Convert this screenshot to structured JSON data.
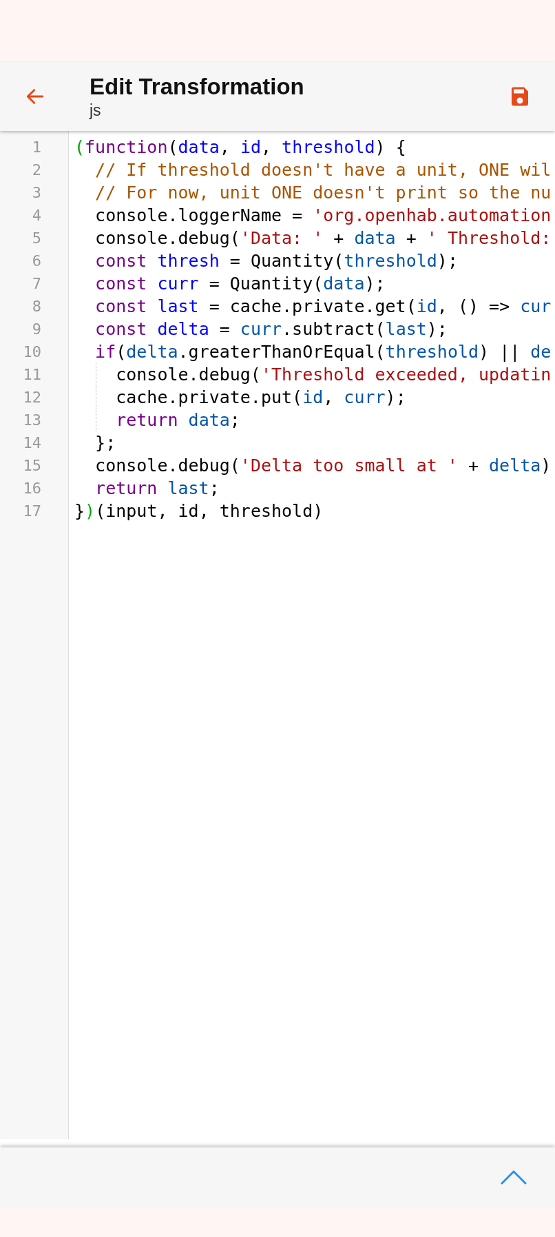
{
  "header": {
    "title": "Edit Transformation",
    "subtitle": "js"
  },
  "editor": {
    "lines": [
      {
        "number": "1",
        "tokens": [
          {
            "kind": "bracket",
            "text": "("
          },
          {
            "kind": "keyword",
            "text": "function"
          },
          {
            "kind": "plain",
            "text": "("
          },
          {
            "kind": "def",
            "text": "data"
          },
          {
            "kind": "plain",
            "text": ", "
          },
          {
            "kind": "def",
            "text": "id"
          },
          {
            "kind": "plain",
            "text": ", "
          },
          {
            "kind": "def",
            "text": "threshold"
          },
          {
            "kind": "plain",
            "text": ") {"
          }
        ]
      },
      {
        "number": "2",
        "tokens": [
          {
            "kind": "comment",
            "text": "  // If threshold doesn't have a unit, ONE wil"
          }
        ]
      },
      {
        "number": "3",
        "tokens": [
          {
            "kind": "comment",
            "text": "  // For now, unit ONE doesn't print so the nu"
          }
        ]
      },
      {
        "number": "4",
        "tokens": [
          {
            "kind": "plain",
            "text": "  console.loggerName = "
          },
          {
            "kind": "string",
            "text": "'org.openhab.automation"
          }
        ]
      },
      {
        "number": "5",
        "tokens": [
          {
            "kind": "plain",
            "text": "  console.debug("
          },
          {
            "kind": "string",
            "text": "'Data: '"
          },
          {
            "kind": "plain",
            "text": " + "
          },
          {
            "kind": "variable",
            "text": "data"
          },
          {
            "kind": "plain",
            "text": " + "
          },
          {
            "kind": "string",
            "text": "' Threshold:"
          }
        ]
      },
      {
        "number": "6",
        "tokens": [
          {
            "kind": "keyword",
            "text": "  const "
          },
          {
            "kind": "def",
            "text": "thresh"
          },
          {
            "kind": "plain",
            "text": " = Quantity("
          },
          {
            "kind": "variable",
            "text": "threshold"
          },
          {
            "kind": "plain",
            "text": ");"
          }
        ]
      },
      {
        "number": "7",
        "tokens": [
          {
            "kind": "keyword",
            "text": "  const "
          },
          {
            "kind": "def",
            "text": "curr"
          },
          {
            "kind": "plain",
            "text": " = Quantity("
          },
          {
            "kind": "variable",
            "text": "data"
          },
          {
            "kind": "plain",
            "text": ");"
          }
        ]
      },
      {
        "number": "8",
        "tokens": [
          {
            "kind": "keyword",
            "text": "  const "
          },
          {
            "kind": "def",
            "text": "last"
          },
          {
            "kind": "plain",
            "text": " = cache.private.get("
          },
          {
            "kind": "variable",
            "text": "id"
          },
          {
            "kind": "plain",
            "text": ", () => "
          },
          {
            "kind": "variable",
            "text": "cur"
          }
        ]
      },
      {
        "number": "9",
        "tokens": [
          {
            "kind": "keyword",
            "text": "  const "
          },
          {
            "kind": "def",
            "text": "delta"
          },
          {
            "kind": "plain",
            "text": " = "
          },
          {
            "kind": "variable",
            "text": "curr"
          },
          {
            "kind": "plain",
            "text": ".subtract("
          },
          {
            "kind": "variable",
            "text": "last"
          },
          {
            "kind": "plain",
            "text": ");"
          }
        ]
      },
      {
        "number": "10",
        "tokens": [
          {
            "kind": "keyword",
            "text": "  if"
          },
          {
            "kind": "plain",
            "text": "("
          },
          {
            "kind": "variable",
            "text": "delta"
          },
          {
            "kind": "plain",
            "text": ".greaterThanOrEqual("
          },
          {
            "kind": "variable",
            "text": "threshold"
          },
          {
            "kind": "plain",
            "text": ") || "
          },
          {
            "kind": "variable",
            "text": "de"
          }
        ]
      },
      {
        "number": "11",
        "indent_guide": true,
        "tokens": [
          {
            "kind": "plain",
            "text": "    console.debug("
          },
          {
            "kind": "string",
            "text": "'Threshold exceeded, updatin"
          }
        ]
      },
      {
        "number": "12",
        "indent_guide": true,
        "tokens": [
          {
            "kind": "plain",
            "text": "    cache.private.put("
          },
          {
            "kind": "variable",
            "text": "id"
          },
          {
            "kind": "plain",
            "text": ", "
          },
          {
            "kind": "variable",
            "text": "curr"
          },
          {
            "kind": "plain",
            "text": ");"
          }
        ]
      },
      {
        "number": "13",
        "indent_guide": true,
        "tokens": [
          {
            "kind": "keyword",
            "text": "    return "
          },
          {
            "kind": "variable",
            "text": "data"
          },
          {
            "kind": "plain",
            "text": ";"
          }
        ]
      },
      {
        "number": "14",
        "tokens": [
          {
            "kind": "plain",
            "text": "  };"
          }
        ]
      },
      {
        "number": "15",
        "tokens": [
          {
            "kind": "plain",
            "text": "  console.debug("
          },
          {
            "kind": "string",
            "text": "'Delta too small at '"
          },
          {
            "kind": "plain",
            "text": " + "
          },
          {
            "kind": "variable",
            "text": "delta"
          },
          {
            "kind": "plain",
            "text": ")"
          }
        ]
      },
      {
        "number": "16",
        "tokens": [
          {
            "kind": "keyword",
            "text": "  return "
          },
          {
            "kind": "variable",
            "text": "last"
          },
          {
            "kind": "plain",
            "text": ";"
          }
        ]
      },
      {
        "number": "17",
        "tokens": [
          {
            "kind": "plain",
            "text": "}"
          },
          {
            "kind": "bracket",
            "text": ")"
          },
          {
            "kind": "plain",
            "text": "(input, id, threshold)"
          }
        ]
      }
    ]
  }
}
